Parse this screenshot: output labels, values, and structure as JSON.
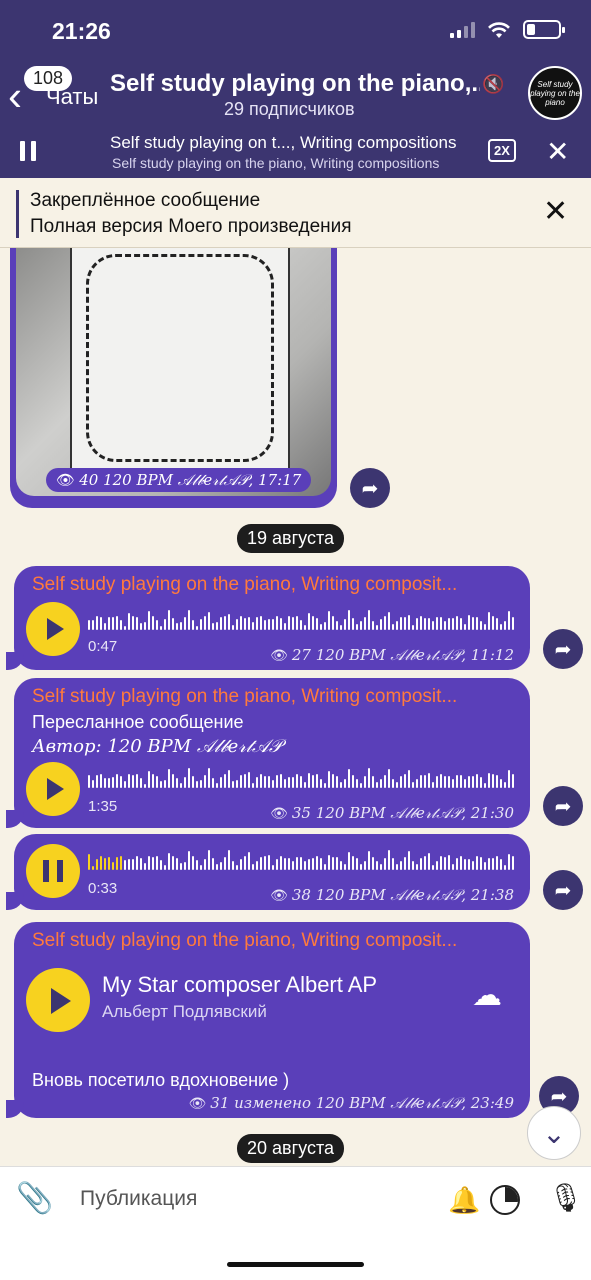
{
  "status": {
    "time": "21:26"
  },
  "header": {
    "back_label": "Чаты",
    "unread_badge": "108",
    "title": "Self study playing on the piano,...",
    "subtitle": "29 подписчиков",
    "avatar_text": "Self study playing on the piano"
  },
  "player": {
    "line1": "Self study playing on t..., Writing compositions",
    "line2": "Self study playing on the piano, Writing compositions",
    "speed": "2X"
  },
  "pinned": {
    "title": "Закреплённое сообщение",
    "text": "Полная версия Моего произведения"
  },
  "messages": {
    "photo": {
      "meta": "40 120 BPM 𝒜𝓁𝒷𝑒𝓇𝓉𝒜𝒫, 17:17"
    },
    "date1": "19 августа",
    "voice1": {
      "title": "Self study playing on the piano, Writing composit...",
      "duration": "0:47",
      "meta": "27 120 BPM 𝒜𝓁𝒷𝑒𝓇𝓉𝒜𝒫, 11:12"
    },
    "voice2": {
      "title": "Self study playing on the piano, Writing composit...",
      "forwarded": "Пересланное сообщение",
      "author": "Автор: 120 BPM 𝒜𝓁𝒷𝑒𝓇𝓉𝒜𝒫",
      "duration": "1:35",
      "meta": "35 120 BPM 𝒜𝓁𝒷𝑒𝓇𝓉𝒜𝒫, 21:30"
    },
    "voice3": {
      "duration": "0:33",
      "meta": "38 120 BPM 𝒜𝓁𝒷𝑒𝓇𝓉𝒜𝒫, 21:38",
      "progress": 0.08
    },
    "song": {
      "title": "Self study playing on the piano, Writing composit...",
      "song_title": "My Star composer Albert AP",
      "artist": "Альберт Подлявский",
      "caption": "Вновь посетило вдохновение )",
      "meta": "31 изменено 120 BPM 𝒜𝓁𝒷𝑒𝓇𝓉𝒜𝒫, 23:49"
    },
    "date2": "20 августа"
  },
  "composer": {
    "placeholder": "Публикация"
  }
}
